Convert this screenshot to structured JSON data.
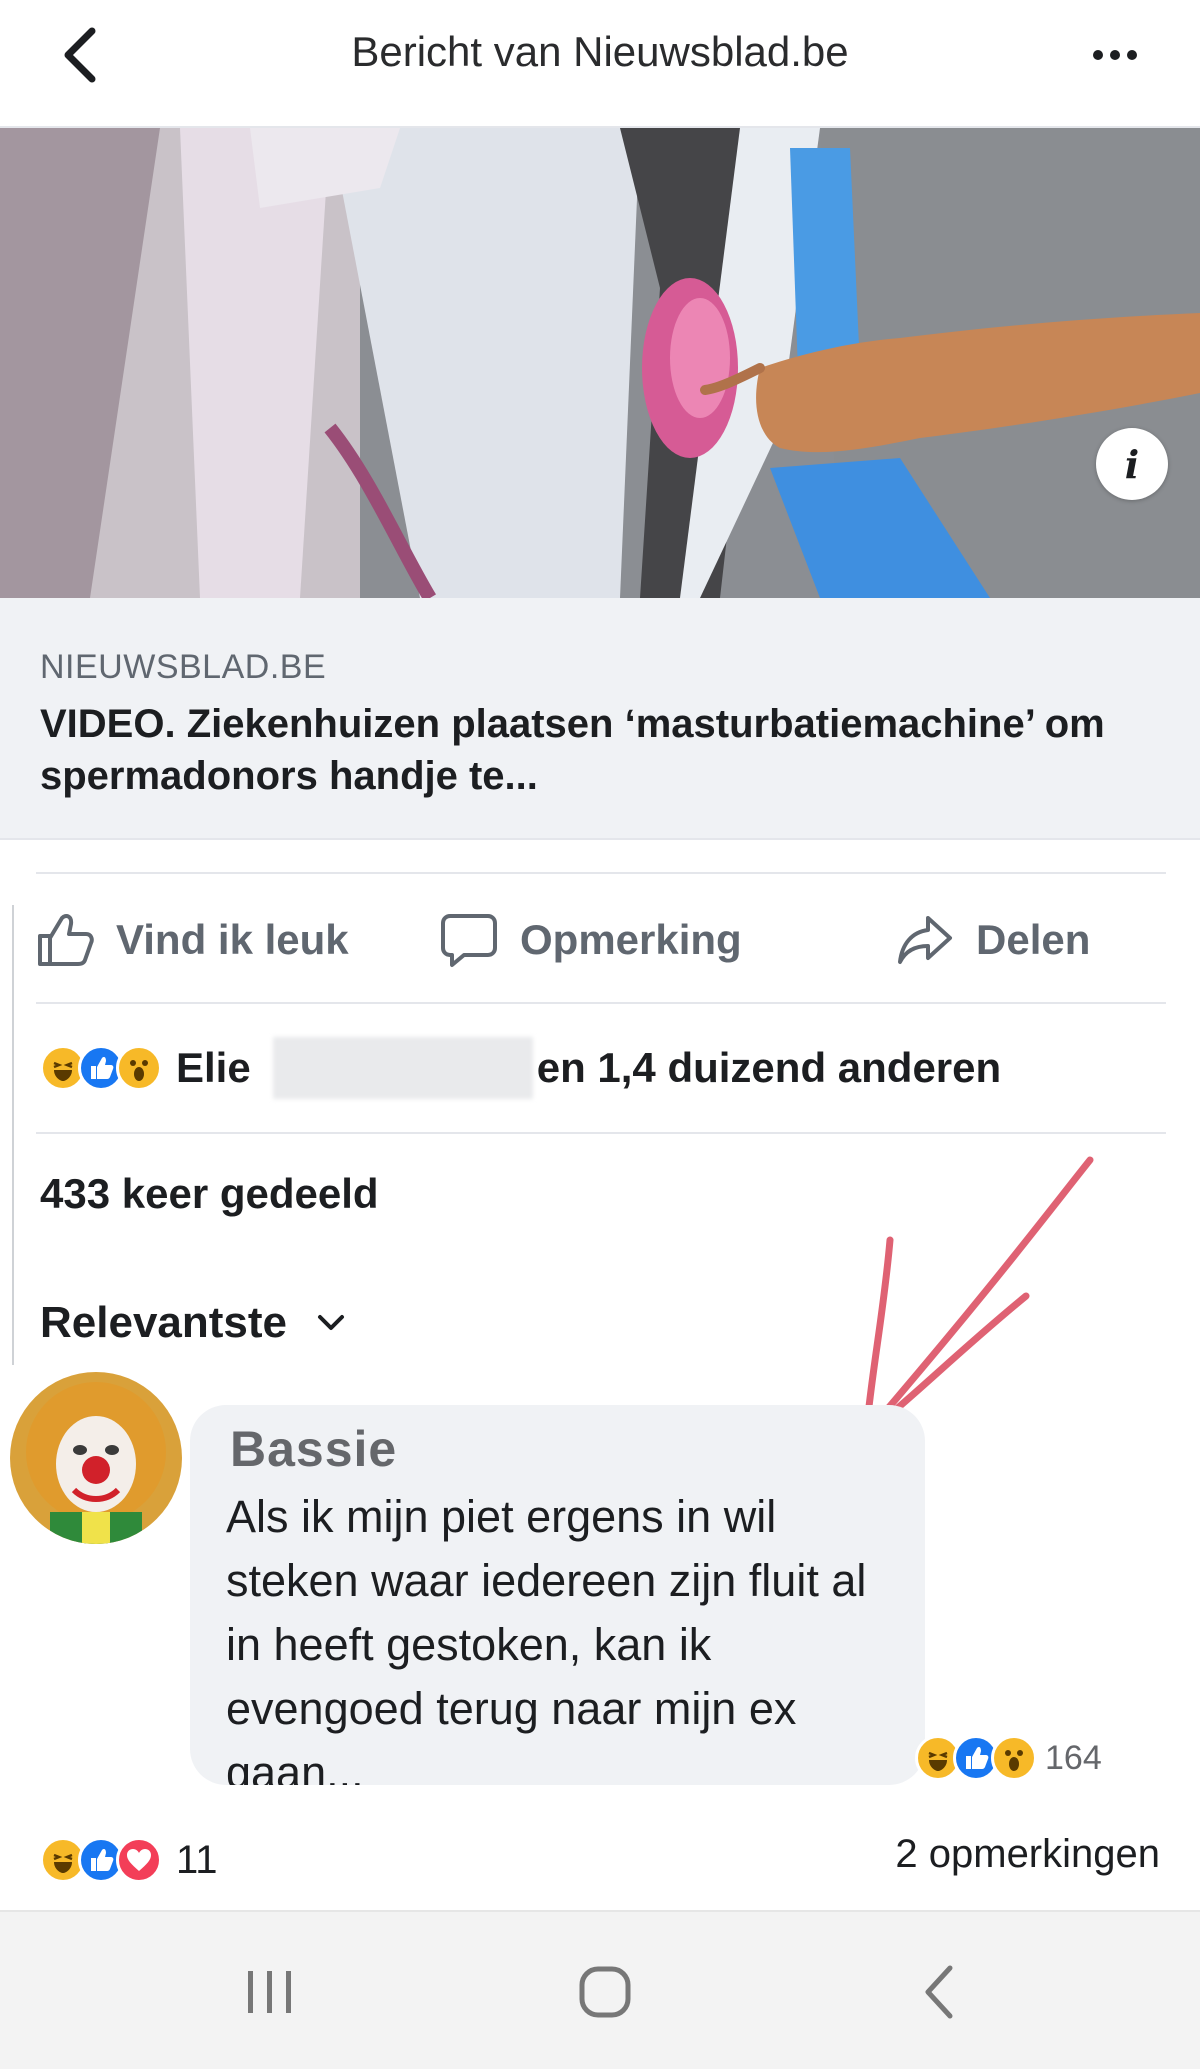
{
  "header": {
    "title": "Bericht van Nieuwsblad.be"
  },
  "link": {
    "domain": "NIEUWSBLAD.BE",
    "title": "VIDEO. Ziekenhuizen plaatsen ‘masturbatiemachine’ om spermadonors handje te..."
  },
  "actions": {
    "like": "Vind ik leuk",
    "comment": "Opmerking",
    "share": "Delen"
  },
  "reactions": {
    "name": "Elie",
    "others": "en 1,4 duizend anderen"
  },
  "shares": "433 keer gedeeld",
  "sort": {
    "label": "Relevantste"
  },
  "comment": {
    "author": "Bassie",
    "text": "Als ik mijn piet ergens in wil steken waar iedereen zijn fluit al in heeft gestoken, kan ik evengoed terug naar mijn ex gaan...",
    "reaction_count": "164"
  },
  "footer": {
    "reaction_count": "11",
    "comments": "2 opmerkingen"
  },
  "colors": {
    "like_blue": "#1877f2",
    "haha_yellow": "#f7b928",
    "love_red": "#f33e58",
    "annotation_red": "#d9475a"
  },
  "icons": [
    "back-arrow-icon",
    "more-dots-icon",
    "info-icon",
    "thumbs-up-icon",
    "comment-bubble-icon",
    "share-arrow-icon",
    "chevron-down-icon",
    "nav-recent-apps-icon",
    "nav-home-icon",
    "nav-back-icon"
  ]
}
